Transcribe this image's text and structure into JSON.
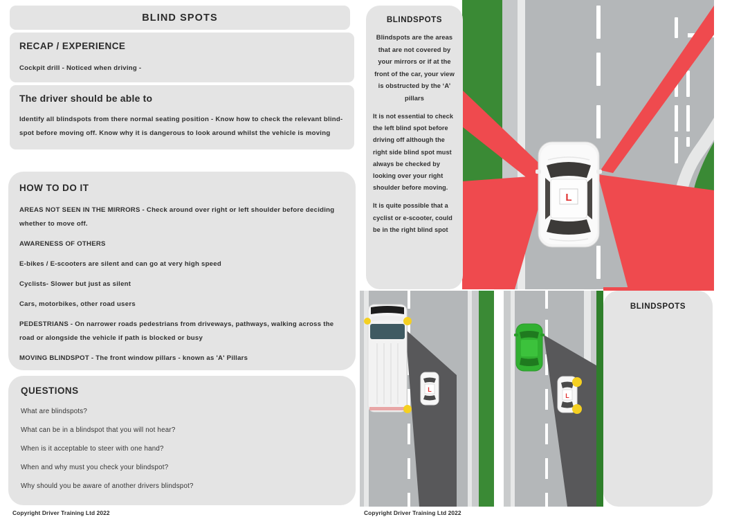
{
  "left": {
    "title_panel": {
      "title": "BLIND SPOTS"
    },
    "recap_panel": {
      "heading": "RECAP / EXPERIENCE",
      "line1": "Cockpit drill - Noticed when driving -"
    },
    "driver_panel": {
      "heading": "The driver should be able to",
      "line1": "Identify all blindspots from there normal seating position - Know how to check the relevant  blind-",
      "line2": "spot before moving off. Know why it is dangerous to look around whilst the vehicle is moving"
    },
    "how_panel": {
      "heading": "HOW TO DO IT",
      "lines": [
        "AREAS NOT SEEN IN THE MIRRORS - Check around over right or left shoulder before deciding",
        "whether to move off.",
        "AWARENESS OF OTHERS",
        "E-bikes / E-scooters are silent and can go at very high speed",
        "Cyclists- Slower but just as silent",
        "Cars, motorbikes, other road users",
        "PEDESTRIANS - On narrower roads pedestrians from driveways, pathways, walking across the",
        "road or alongside the vehicle if path is blocked or busy",
        "MOVING BLINDSPOT - The front window pillars - known as 'A' Pillars"
      ]
    },
    "questions_panel": {
      "heading": "QUESTIONS",
      "items": [
        "What are blindspots?",
        "What can be in a blindspot that you will not hear?",
        "When is it acceptable to steer with one hand?",
        "When and why must you check your blindspot?",
        "Why should you be aware of another drivers blindspot?"
      ]
    },
    "footer": "Copyright Driver Training Ltd 2022"
  },
  "right": {
    "info_panel": {
      "title": "BLINDSPOTS",
      "para_center": "Blindspots are the areas that are not covered by your mirrors or if at the front of the car, your view is obstructed by the ‘A’ pillars",
      "para_2": "It is not essential to check the left blind spot before driving off although the right side blind spot must always be checked by looking over your right shoulder before moving.",
      "para_3": "It is quite possible that a cyclist or e-scooter, could be in the right blind spot"
    },
    "blindspots_box": {
      "label": "BLINDSPOTS"
    },
    "footer": "Copyright Driver Training Ltd 2022",
    "scene_labels": {
      "top_scene": "top-down-road-with-learner-car-and-blindspot-cones",
      "van_scene": "van-blindspot-hides-learner-car",
      "green_car_scene": "green-car-blindspot-hides-learner-car"
    },
    "l_plate": "L"
  },
  "colors": {
    "panel_bg": "#e4e4e4",
    "text": "#2b2b2b",
    "road": "#b4b7b9",
    "pavement": "#c6c8ca",
    "grass": "#3a8a35",
    "blindspot_red": "#ef4a4e",
    "blindspot_grey": "#58585a",
    "line_white": "#ffffff",
    "car_white": "#f2f2f2",
    "car_green": "#31b031",
    "mirror_yellow": "#f5d021",
    "l_plate_red": "#e0302f"
  }
}
